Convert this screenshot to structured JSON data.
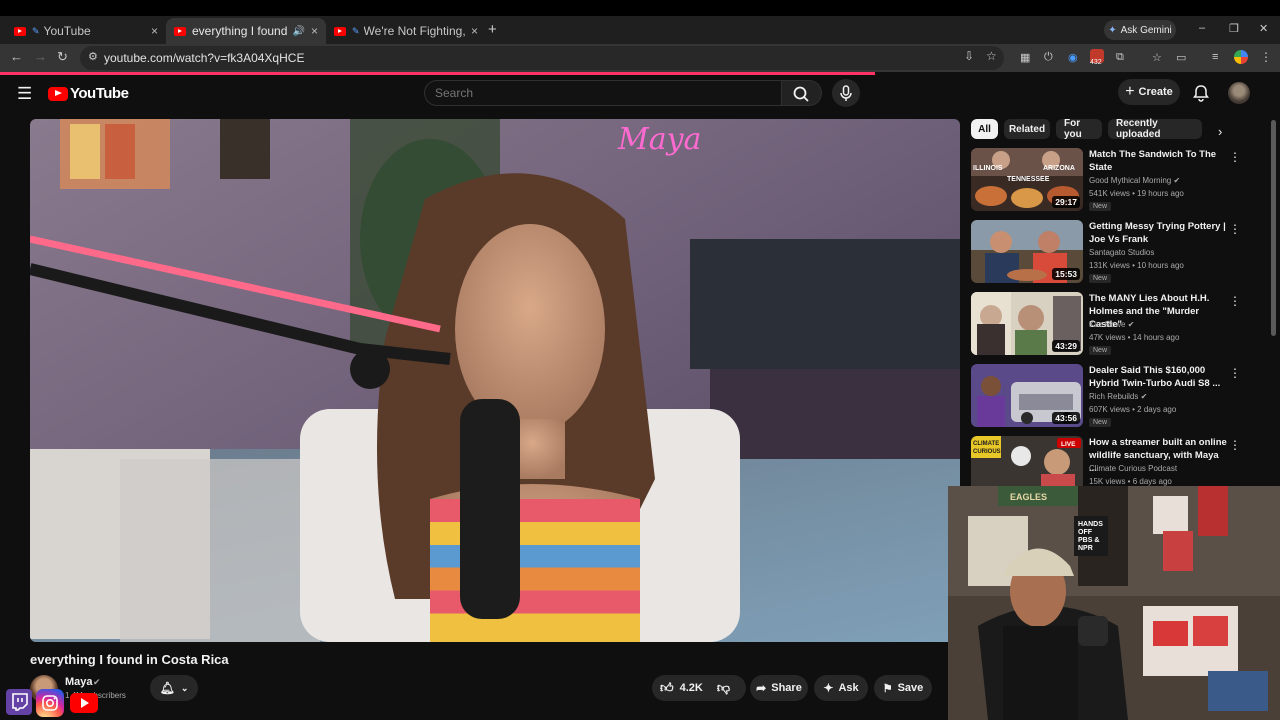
{
  "browser": {
    "tabs": [
      {
        "label": "YouTube",
        "close": "×"
      },
      {
        "label": "everything I found in Costa Rica",
        "close": "×"
      },
      {
        "label": "We're Not Fighting, We're Dating",
        "close": "×"
      }
    ],
    "new_tab": "+",
    "ask_gemini": "Ask Gemini",
    "window_controls": [
      "–",
      "❐",
      "✕"
    ],
    "url": "youtube.com/watch?v=fk3A04XqHCE",
    "extension_badge": "432"
  },
  "youtube": {
    "logo_text": "YouTube",
    "search_placeholder": "Search",
    "create_label": "Create",
    "filters": [
      "All",
      "Related",
      "For you",
      "Recently uploaded"
    ],
    "video": {
      "neon_sign": "Maya",
      "title": "everything I found in Costa Rica",
      "channel": "Maya",
      "subscribers": "1.4M subscribers",
      "likes": "4.2K",
      "share": "Share",
      "ask": "Ask",
      "save": "Save"
    },
    "recommendations": [
      {
        "title": "Match The Sandwich To The State",
        "channel": "Good Mythical Morning",
        "meta": "541K views • 19 hours ago",
        "badge": "New",
        "duration": "29:17",
        "thumb_text": [
          "ILLINOIS",
          "ARIZONA",
          "TENNESSEE"
        ]
      },
      {
        "title": "Getting Messy Trying Pottery | Joe Vs Frank",
        "channel": "Santagato Studios",
        "meta": "131K views • 10 hours ago",
        "badge": "New",
        "duration": "15:53"
      },
      {
        "title": "The MANY Lies About H.H. Holmes and the \"Murder Castle\"",
        "channel": "Kaz Rowe",
        "meta": "47K views • 14 hours ago",
        "badge": "New",
        "duration": "43:29"
      },
      {
        "title": "Dealer Said This $160,000 Hybrid Twin-Turbo Audi S8 ...",
        "channel": "Rich Rebuilds",
        "meta": "607K views • 2 days ago",
        "badge": "New",
        "duration": "43:56"
      },
      {
        "title": "How a streamer built an online wildlife sanctuary, with Maya ...",
        "channel": "Climate Curious Podcast",
        "meta": "15K views • 6 days ago",
        "badge": "",
        "duration": "",
        "thumb_text": [
          "CLIMATE",
          "CURIOUS"
        ],
        "live": "LIVE"
      }
    ]
  },
  "webcam": {
    "poster_text": [
      "HANDS",
      "OFF",
      "PBS &",
      "NPR"
    ],
    "banner_text": "EAGLES"
  },
  "colors": {
    "youtube_red": "#ff0000",
    "accent_pink": "#ff3366",
    "bg": "#0f0f0f"
  }
}
